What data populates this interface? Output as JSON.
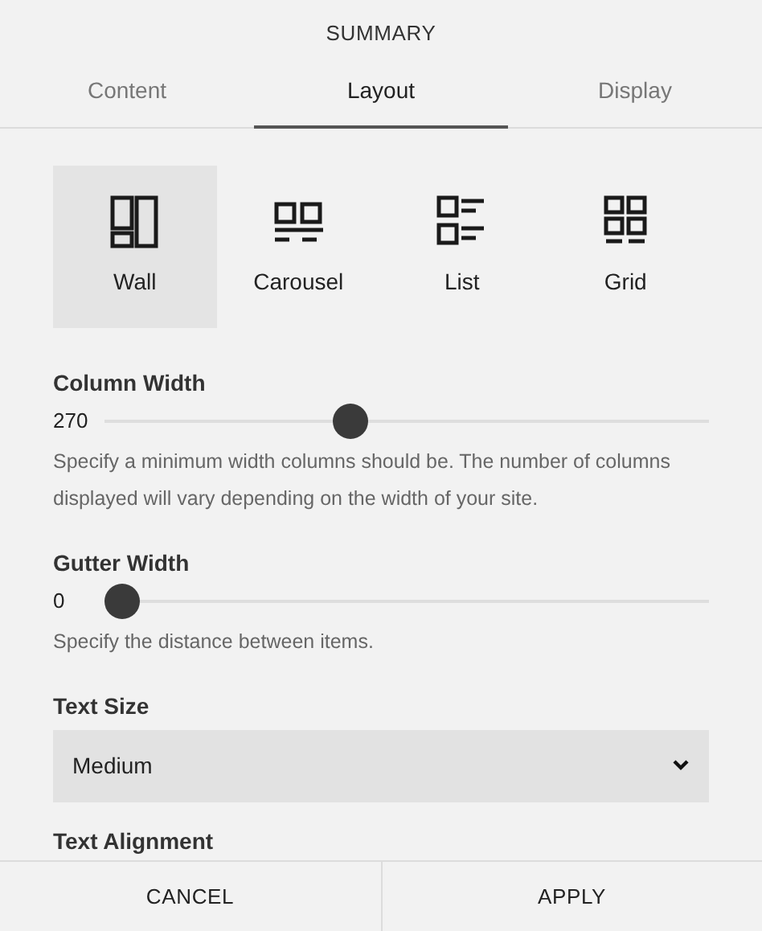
{
  "title": "SUMMARY",
  "tabs": [
    {
      "label": "Content",
      "selected": false
    },
    {
      "label": "Layout",
      "selected": true
    },
    {
      "label": "Display",
      "selected": false
    }
  ],
  "layouts": [
    {
      "kind": "wall",
      "label": "Wall",
      "selected": true
    },
    {
      "kind": "carousel",
      "label": "Carousel",
      "selected": false
    },
    {
      "kind": "list",
      "label": "List",
      "selected": false
    },
    {
      "kind": "grid",
      "label": "Grid",
      "selected": false
    }
  ],
  "sliders": [
    {
      "label": "Column Width",
      "reading": "270",
      "level": 0.4,
      "help": "Specify a minimum width columns should be. The number of columns displayed will vary depending on the width of your site."
    },
    {
      "label": "Gutter Width",
      "reading": "0",
      "level": 0,
      "help": "Specify the distance between items."
    }
  ],
  "text_size": {
    "label": "Text Size",
    "value": "Medium"
  },
  "next_label": "Text Alignment",
  "buttons": [
    "CANCEL",
    "APPLY"
  ]
}
